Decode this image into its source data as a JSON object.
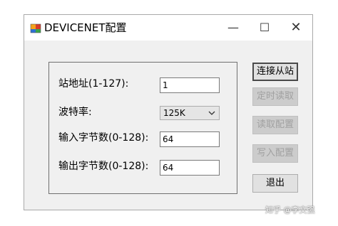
{
  "window": {
    "title": "DEVICENET配置",
    "minimize_glyph": "—",
    "maximize_glyph": "☐",
    "close_glyph": "✕"
  },
  "form": {
    "station_address": {
      "label": "站地址(1-127):",
      "value": "1"
    },
    "baud_rate": {
      "label": "波特率:",
      "selected": "125K"
    },
    "input_bytes": {
      "label": "输入字节数(0-128):",
      "value": "64"
    },
    "output_bytes": {
      "label": "输出字节数(0-128):",
      "value": "64"
    }
  },
  "buttons": {
    "connect": "连接从站",
    "timed_read": "定时读取",
    "read_config": "读取配置",
    "write_config": "写入配置",
    "exit": "退出"
  },
  "watermark": "知乎 @李文强",
  "colors": {
    "window_bg": "#f0f0f0",
    "titlebar_bg": "#ffffff",
    "disabled_button_bg": "#cccccc",
    "disabled_text": "#a0a0a0"
  },
  "icons": {
    "app": "devicenet-app-icon",
    "dropdown": "chevron-down-icon"
  }
}
